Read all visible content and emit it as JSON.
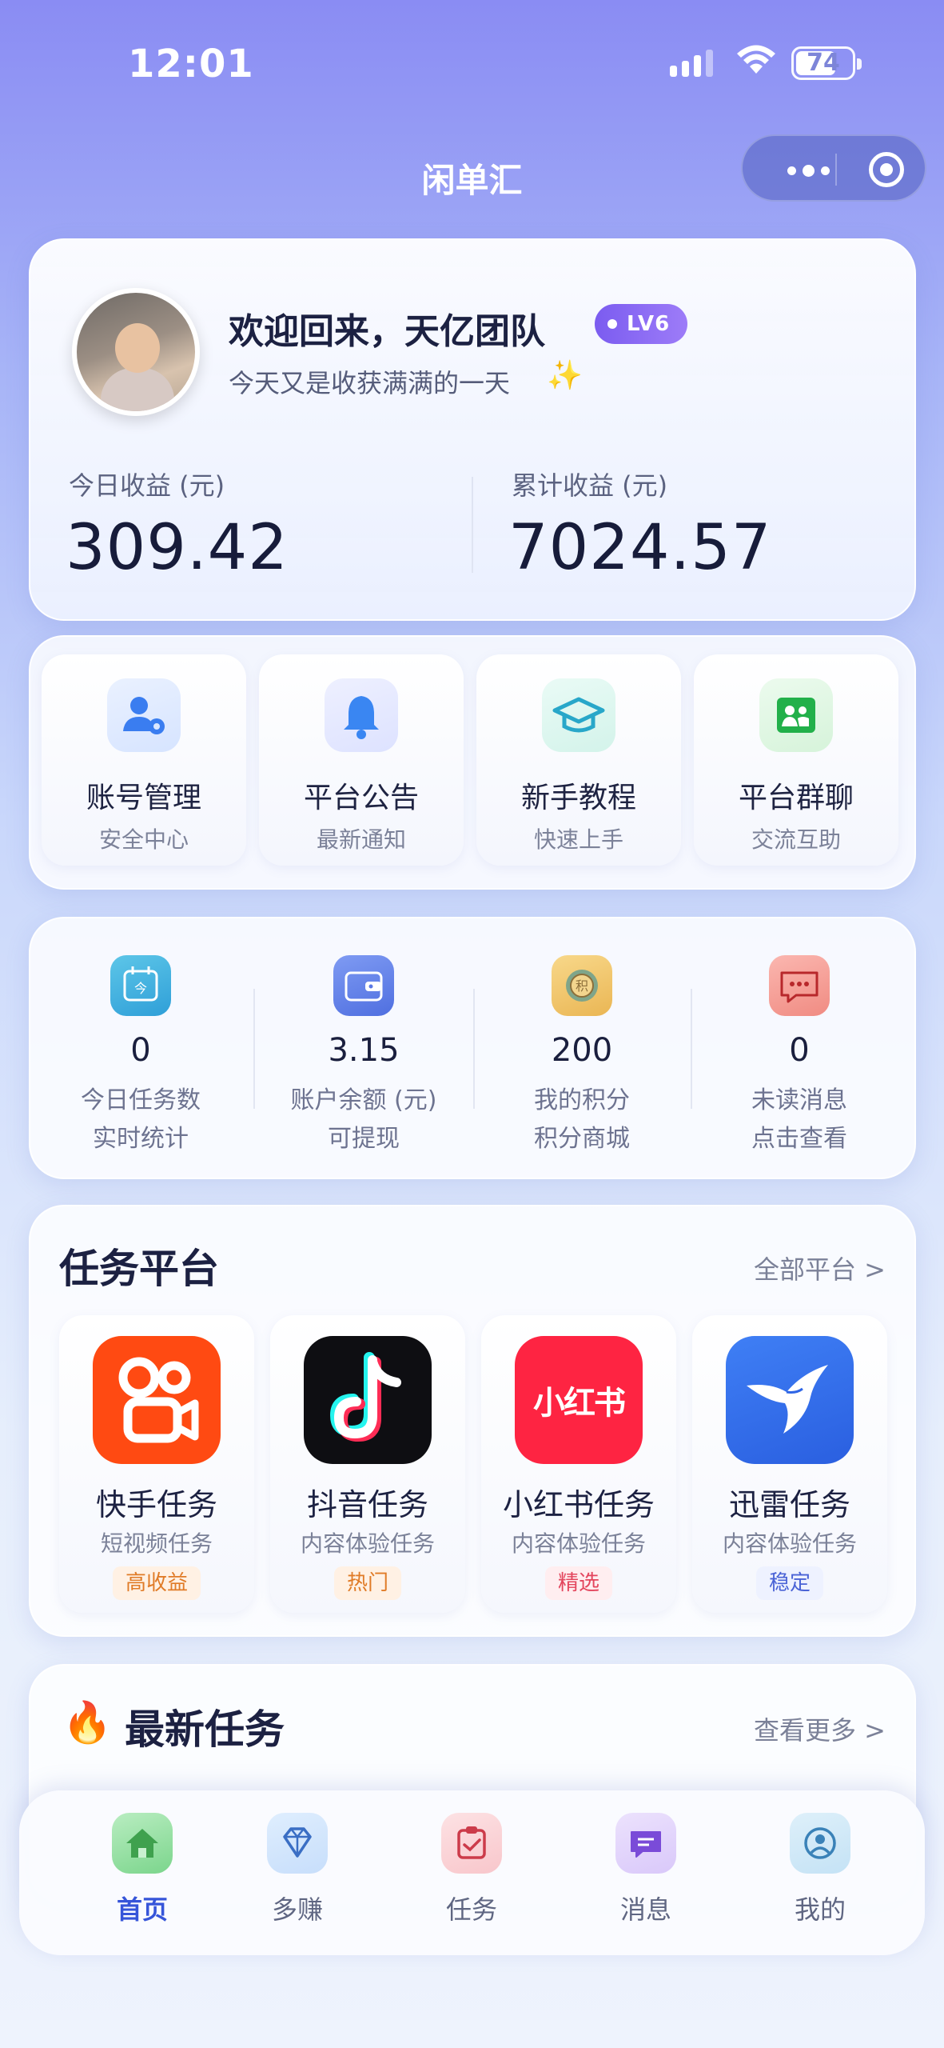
{
  "status_bar": {
    "time": "12:01",
    "battery": "74",
    "battery_level": 0.74
  },
  "nav": {
    "title": "闲单汇"
  },
  "profile": {
    "welcome": "欢迎回来，天亿团队",
    "level": "LV6",
    "subtitle": "今天又是收获满满的一天",
    "today_label": "今日收益 (元)",
    "today_value": "309.42",
    "total_label": "累计收益 (元)",
    "total_value": "7024.57"
  },
  "quick_actions": [
    {
      "label": "账号管理",
      "sub": "安全中心",
      "icon": "user-gear-icon"
    },
    {
      "label": "平台公告",
      "sub": "最新通知",
      "icon": "bell-icon"
    },
    {
      "label": "新手教程",
      "sub": "快速上手",
      "icon": "graduation-cap-icon"
    },
    {
      "label": "平台群聊",
      "sub": "交流互助",
      "icon": "group-chat-icon"
    }
  ],
  "stats": [
    {
      "value": "0",
      "label": "今日任务数",
      "sub": "实时统计",
      "icon": "calendar-today-icon"
    },
    {
      "value": "3.15",
      "label": "账户余额 (元)",
      "sub": "可提现",
      "icon": "wallet-icon"
    },
    {
      "value": "200",
      "label": "我的积分",
      "sub": "积分商城",
      "icon": "points-coin-icon"
    },
    {
      "value": "0",
      "label": "未读消息",
      "sub": "点击查看",
      "icon": "message-icon"
    }
  ],
  "platforms": {
    "title": "任务平台",
    "more": "全部平台 >",
    "items": [
      {
        "name": "快手任务",
        "sub": "短视频任务",
        "tag": "高收益",
        "icon": "kuaishou-logo-icon"
      },
      {
        "name": "抖音任务",
        "sub": "内容体验任务",
        "tag": "热门",
        "icon": "douyin-logo-icon"
      },
      {
        "name": "小红书任务",
        "sub": "内容体验任务",
        "tag": "精选",
        "icon": "xiaohongshu-logo-icon",
        "logo_text": "小红书"
      },
      {
        "name": "迅雷任务",
        "sub": "内容体验任务",
        "tag": "稳定",
        "icon": "xunlei-logo-icon"
      }
    ]
  },
  "latest": {
    "title": "最新任务",
    "more": "查看更多 >"
  },
  "tabbar": [
    {
      "label": "首页",
      "icon": "home-icon",
      "active": true
    },
    {
      "label": "多赚",
      "icon": "diamond-icon"
    },
    {
      "label": "任务",
      "icon": "task-icon"
    },
    {
      "label": "消息",
      "icon": "chat-icon"
    },
    {
      "label": "我的",
      "icon": "profile-icon"
    }
  ],
  "colors": {
    "accent": "#3655d9",
    "lv_badge": "#8b6cf4"
  }
}
